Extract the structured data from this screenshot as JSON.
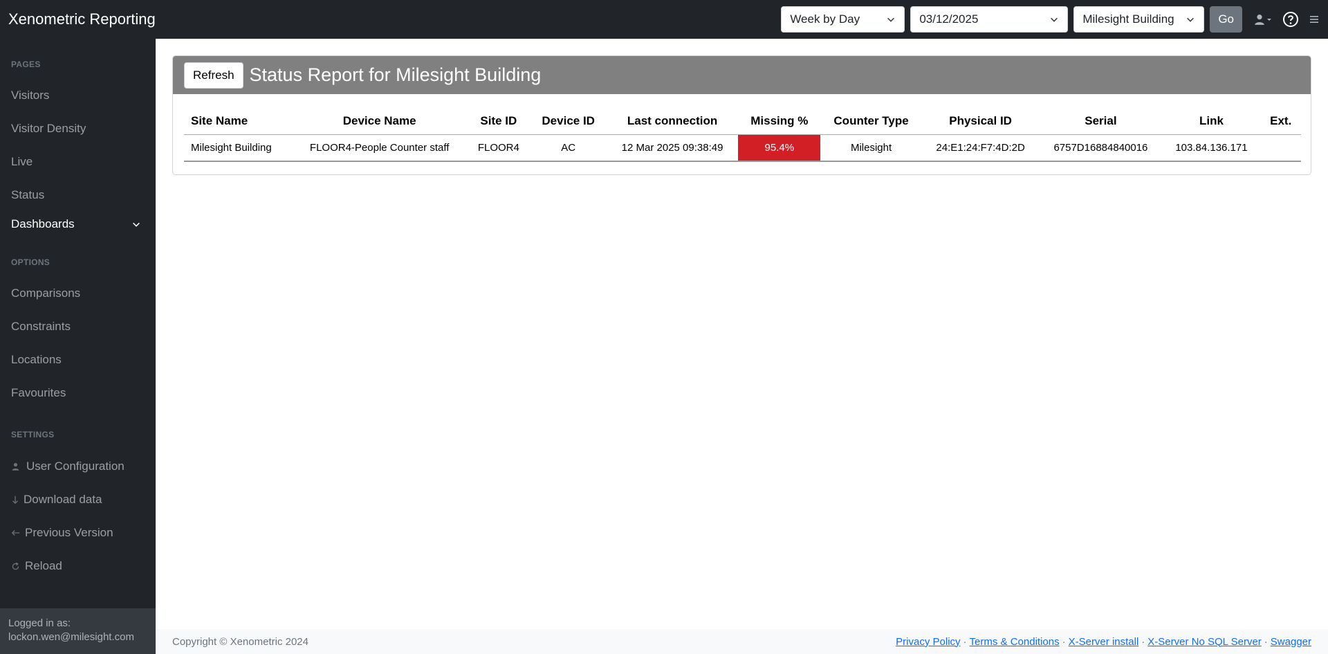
{
  "app": {
    "title": "Xenometric Reporting"
  },
  "topbar": {
    "period_select": "Week by Day",
    "date_select": "03/12/2025",
    "building_select": "Milesight Building",
    "go_label": "Go"
  },
  "sidebar": {
    "pages_heading": "PAGES",
    "pages": [
      {
        "label": "Visitors"
      },
      {
        "label": "Visitor Density"
      },
      {
        "label": "Live"
      },
      {
        "label": "Status"
      },
      {
        "label": "Dashboards"
      }
    ],
    "options_heading": "OPTIONS",
    "options": [
      {
        "label": "Comparisons"
      },
      {
        "label": "Constraints"
      },
      {
        "label": "Locations"
      },
      {
        "label": "Favourites"
      }
    ],
    "settings_heading": "SETTINGS",
    "settings": [
      {
        "label": "User Configuration",
        "icon": "user-icon"
      },
      {
        "label": "Download data",
        "icon": "arrow-down-icon"
      },
      {
        "label": "Previous Version",
        "icon": "arrow-left-icon"
      },
      {
        "label": "Reload",
        "icon": "reload-icon"
      }
    ],
    "logged_in_label": "Logged in as:",
    "logged_in_user": "lockon.wen@milesight.com"
  },
  "report": {
    "refresh_label": "Refresh",
    "title": "Status Report for Milesight Building",
    "columns": [
      "Site Name",
      "Device Name",
      "Site ID",
      "Device ID",
      "Last connection",
      "Missing %",
      "Counter Type",
      "Physical ID",
      "Serial",
      "Link",
      "Ext."
    ],
    "rows": [
      {
        "site_name": "Milesight Building",
        "device_name": "FLOOR4-People Counter staff",
        "site_id": "FLOOR4",
        "device_id": "AC",
        "last_connection": "12 Mar 2025 09:38:49",
        "missing": "95.4%",
        "counter_type": "Milesight",
        "physical_id": "24:E1:24:F7:4D:2D",
        "serial": "6757D16884840016",
        "link": "103.84.136.171",
        "ext": ""
      }
    ],
    "missing_color": "#d11f25"
  },
  "footer": {
    "copyright": "Copyright © Xenometric 2024",
    "links": [
      "Privacy Policy",
      "Terms & Conditions",
      "X-Server install",
      "X-Server No SQL Server",
      "Swagger"
    ]
  }
}
